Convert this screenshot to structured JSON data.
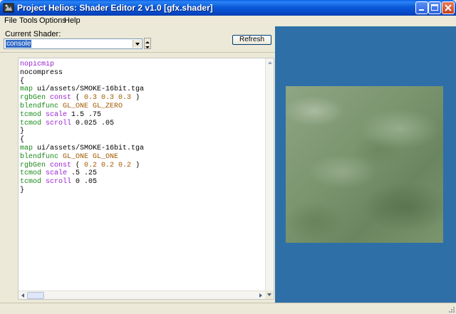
{
  "window": {
    "title": "Project Helios: Shader Editor 2 v1.0 [gfx.shader]"
  },
  "menu": [
    "File",
    "Tools",
    "Options",
    "Help"
  ],
  "shader_picker": {
    "label": "Current Shader:",
    "selected": "console"
  },
  "toolbar": {
    "refresh_label": "Refresh"
  },
  "editor": {
    "lines": [
      [
        {
          "t": "nopicmip",
          "c": "#9a1fd1"
        }
      ],
      [
        {
          "t": "nocompress",
          "c": "#000000"
        }
      ],
      [
        {
          "t": "{",
          "c": "#000000"
        }
      ],
      [
        {
          "t": "map ",
          "c": "#1a8a1a"
        },
        {
          "t": "ui/assets/SMOKE-16bit.tga",
          "c": "#000000"
        }
      ],
      [
        {
          "t": "rgbGen ",
          "c": "#1a8a1a"
        },
        {
          "t": "const ",
          "c": "#9a1fd1"
        },
        {
          "t": "( ",
          "c": "#000000"
        },
        {
          "t": "0.3 0.3 0.3",
          "c": "#a05a00"
        },
        {
          "t": " )",
          "c": "#000000"
        }
      ],
      [
        {
          "t": "blendfunc ",
          "c": "#1a8a1a"
        },
        {
          "t": "GL_ONE GL_ZERO",
          "c": "#a05a00"
        }
      ],
      [
        {
          "t": "tcmod ",
          "c": "#1a8a1a"
        },
        {
          "t": "scale ",
          "c": "#9a1fd1"
        },
        {
          "t": "1.5 .75",
          "c": "#000000"
        }
      ],
      [
        {
          "t": "tcmod ",
          "c": "#1a8a1a"
        },
        {
          "t": "scroll ",
          "c": "#9a1fd1"
        },
        {
          "t": "0.025 .05",
          "c": "#000000"
        }
      ],
      [
        {
          "t": "}",
          "c": "#000000"
        }
      ],
      [
        {
          "t": "{",
          "c": "#000000"
        }
      ],
      [
        {
          "t": "map ",
          "c": "#1a8a1a"
        },
        {
          "t": "ui/assets/SMOKE-16bit.tga",
          "c": "#000000"
        }
      ],
      [
        {
          "t": "blendfunc ",
          "c": "#1a8a1a"
        },
        {
          "t": "GL_ONE GL_ONE",
          "c": "#a05a00"
        }
      ],
      [
        {
          "t": "rgbGen ",
          "c": "#1a8a1a"
        },
        {
          "t": "const ",
          "c": "#9a1fd1"
        },
        {
          "t": "( ",
          "c": "#000000"
        },
        {
          "t": "0.2 0.2 0.2",
          "c": "#a05a00"
        },
        {
          "t": " )",
          "c": "#000000"
        }
      ],
      [
        {
          "t": "tcmod ",
          "c": "#1a8a1a"
        },
        {
          "t": "scale ",
          "c": "#9a1fd1"
        },
        {
          "t": ".5 .25",
          "c": "#000000"
        }
      ],
      [
        {
          "t": "tcmod ",
          "c": "#1a8a1a"
        },
        {
          "t": "scroll ",
          "c": "#9a1fd1"
        },
        {
          "t": "0 .05",
          "c": "#000000"
        }
      ],
      [
        {
          "t": "}",
          "c": "#000000"
        }
      ]
    ]
  },
  "colors": {
    "preview_background": "#2e6fa8",
    "title_bar": "#0a5ee6",
    "selection": "#316ac5"
  },
  "icons": [
    "app-icon",
    "minimize-icon",
    "maximize-icon",
    "close-icon",
    "dropdown-arrow-icon",
    "spin-up-icon",
    "spin-down-icon",
    "scroll-up-icon",
    "scroll-down-icon",
    "scroll-left-icon",
    "scroll-right-icon",
    "resize-grip-icon"
  ]
}
